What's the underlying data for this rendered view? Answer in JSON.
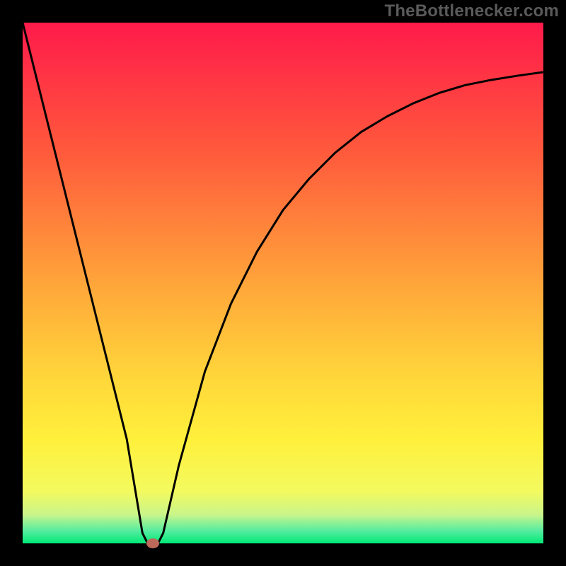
{
  "watermark": "TheBottlenecker.com",
  "colors": {
    "frame": "#000000",
    "curve": "#000000",
    "marker": "#be6959",
    "green": "#00e977",
    "yellow": "#fff03b",
    "red": "#ff1a4a"
  },
  "chart_data": {
    "type": "line",
    "title": "",
    "xlabel": "",
    "ylabel": "",
    "xlim": [
      0,
      100
    ],
    "ylim": [
      0,
      100
    ],
    "grid": false,
    "legend": false,
    "marker": {
      "x": 25,
      "y": 0
    },
    "curve": [
      {
        "x": 0,
        "y": 100
      },
      {
        "x": 5,
        "y": 80
      },
      {
        "x": 10,
        "y": 60
      },
      {
        "x": 15,
        "y": 40
      },
      {
        "x": 20,
        "y": 20
      },
      {
        "x": 23,
        "y": 2
      },
      {
        "x": 24,
        "y": 0
      },
      {
        "x": 25,
        "y": 0
      },
      {
        "x": 26,
        "y": 0
      },
      {
        "x": 27,
        "y": 2
      },
      {
        "x": 30,
        "y": 15
      },
      {
        "x": 35,
        "y": 33
      },
      {
        "x": 40,
        "y": 46
      },
      {
        "x": 45,
        "y": 56
      },
      {
        "x": 50,
        "y": 64
      },
      {
        "x": 55,
        "y": 70
      },
      {
        "x": 60,
        "y": 75
      },
      {
        "x": 65,
        "y": 79
      },
      {
        "x": 70,
        "y": 82
      },
      {
        "x": 75,
        "y": 84.5
      },
      {
        "x": 80,
        "y": 86.5
      },
      {
        "x": 85,
        "y": 88
      },
      {
        "x": 90,
        "y": 89
      },
      {
        "x": 95,
        "y": 89.8
      },
      {
        "x": 100,
        "y": 90.5
      }
    ],
    "gradient_stops": [
      {
        "offset": 0,
        "color": "#ff1a4a"
      },
      {
        "offset": 0.25,
        "color": "#ff5a3c"
      },
      {
        "offset": 0.5,
        "color": "#ffa53a"
      },
      {
        "offset": 0.68,
        "color": "#ffd63a"
      },
      {
        "offset": 0.8,
        "color": "#fff03b"
      },
      {
        "offset": 0.9,
        "color": "#f3fa5f"
      },
      {
        "offset": 0.945,
        "color": "#c9f58a"
      },
      {
        "offset": 0.975,
        "color": "#59eda0"
      },
      {
        "offset": 1.0,
        "color": "#00e977"
      }
    ]
  }
}
